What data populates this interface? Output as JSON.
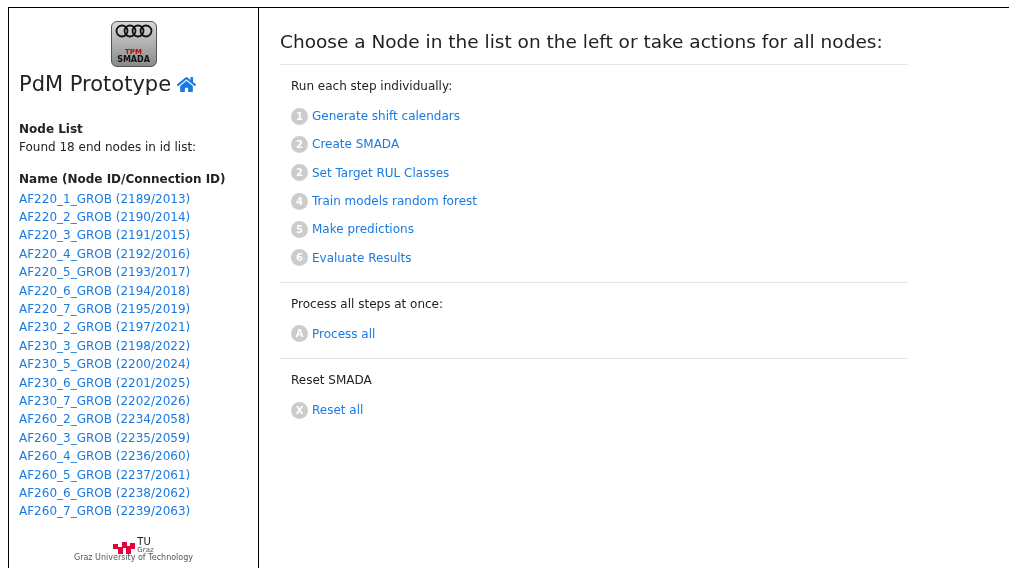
{
  "sidebar": {
    "logo": {
      "top_text": "TPM",
      "bottom_text": "SMADA"
    },
    "title": "PdM Prototype",
    "section_title": "Node List",
    "found_text": "Found 18 end nodes in id list:",
    "list_heading": "Name (Node ID/Connection ID)",
    "nodes": [
      "AF220_1_GROB (2189/2013)",
      "AF220_2_GROB (2190/2014)",
      "AF220_3_GROB (2191/2015)",
      "AF220_4_GROB (2192/2016)",
      "AF220_5_GROB (2193/2017)",
      "AF220_6_GROB (2194/2018)",
      "AF220_7_GROB (2195/2019)",
      "AF230_2_GROB (2197/2021)",
      "AF230_3_GROB (2198/2022)",
      "AF230_5_GROB (2200/2024)",
      "AF230_6_GROB (2201/2025)",
      "AF230_7_GROB (2202/2026)",
      "AF260_2_GROB (2234/2058)",
      "AF260_3_GROB (2235/2059)",
      "AF260_4_GROB (2236/2060)",
      "AF260_5_GROB (2237/2061)",
      "AF260_6_GROB (2238/2062)",
      "AF260_7_GROB (2239/2063)"
    ],
    "footer_logo": {
      "name": "TU",
      "city": "Graz",
      "tagline": "Graz University of Technology"
    }
  },
  "main": {
    "heading": "Choose a Node in the list on the left or take actions for all nodes:",
    "sections": [
      {
        "title": "Run each step individually:",
        "actions": [
          {
            "badge": "1",
            "label": "Generate shift calendars"
          },
          {
            "badge": "2",
            "label": "Create SMADA"
          },
          {
            "badge": "2",
            "label": "Set Target RUL Classes"
          },
          {
            "badge": "4",
            "label": "Train models random forest"
          },
          {
            "badge": "5",
            "label": "Make predictions"
          },
          {
            "badge": "6",
            "label": "Evaluate Results"
          }
        ]
      },
      {
        "title": "Process all steps at once:",
        "actions": [
          {
            "badge": "A",
            "label": "Process all"
          }
        ]
      },
      {
        "title": "Reset SMADA",
        "actions": [
          {
            "badge": "X",
            "label": "Reset all"
          }
        ]
      }
    ]
  }
}
